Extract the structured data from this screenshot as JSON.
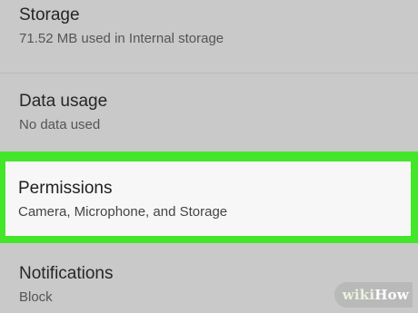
{
  "settings": {
    "items": [
      {
        "title": "Storage",
        "subtitle": "71.52 MB used in Internal storage"
      },
      {
        "title": "Data usage",
        "subtitle": "No data used"
      },
      {
        "title": "Permissions",
        "subtitle": "Camera, Microphone, and Storage"
      },
      {
        "title": "Notifications",
        "subtitle": "Block"
      }
    ]
  },
  "watermark": {
    "part1": "wiki",
    "part2": "How"
  },
  "colors": {
    "highlight": "#44e62b",
    "background": "#c9c9c9",
    "highlighted_item_bg": "#f7f7f7"
  }
}
